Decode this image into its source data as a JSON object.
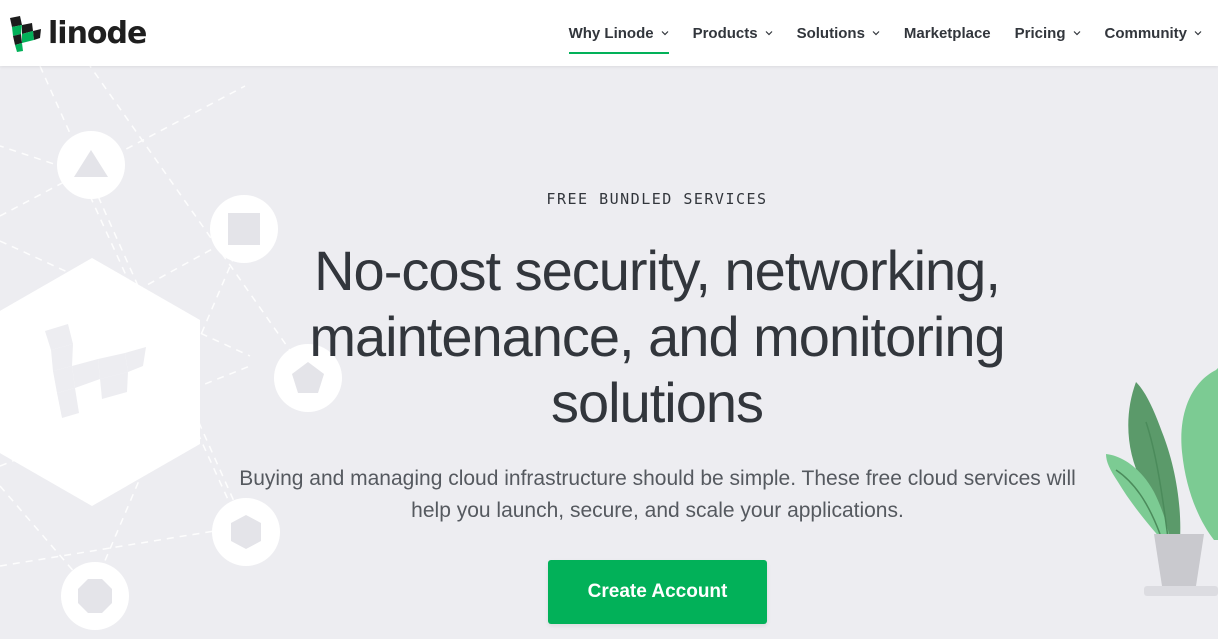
{
  "brand": {
    "name": "linode",
    "accent": "#02b159"
  },
  "nav": {
    "items": [
      {
        "label": "Why Linode",
        "has_dropdown": true,
        "active": true
      },
      {
        "label": "Products",
        "has_dropdown": true
      },
      {
        "label": "Solutions",
        "has_dropdown": true
      },
      {
        "label": "Marketplace",
        "has_dropdown": false
      },
      {
        "label": "Pricing",
        "has_dropdown": true
      },
      {
        "label": "Community",
        "has_dropdown": true
      }
    ]
  },
  "hero": {
    "eyebrow": "FREE BUNDLED SERVICES",
    "headline": "No-cost security, networking, maintenance, and monitoring solutions",
    "subtext": "Buying and managing cloud infrastructure should be simple. These free cloud services will help you launch, secure, and scale your applications.",
    "cta_label": "Create Account"
  },
  "decor": {
    "left_icons": [
      "triangle-icon",
      "square-icon",
      "pentagon-icon",
      "hexagon-icon",
      "octagon-icon"
    ],
    "center_badge": "linode-logo-hexagon",
    "right_illustration": "potted-plant-illustration"
  }
}
